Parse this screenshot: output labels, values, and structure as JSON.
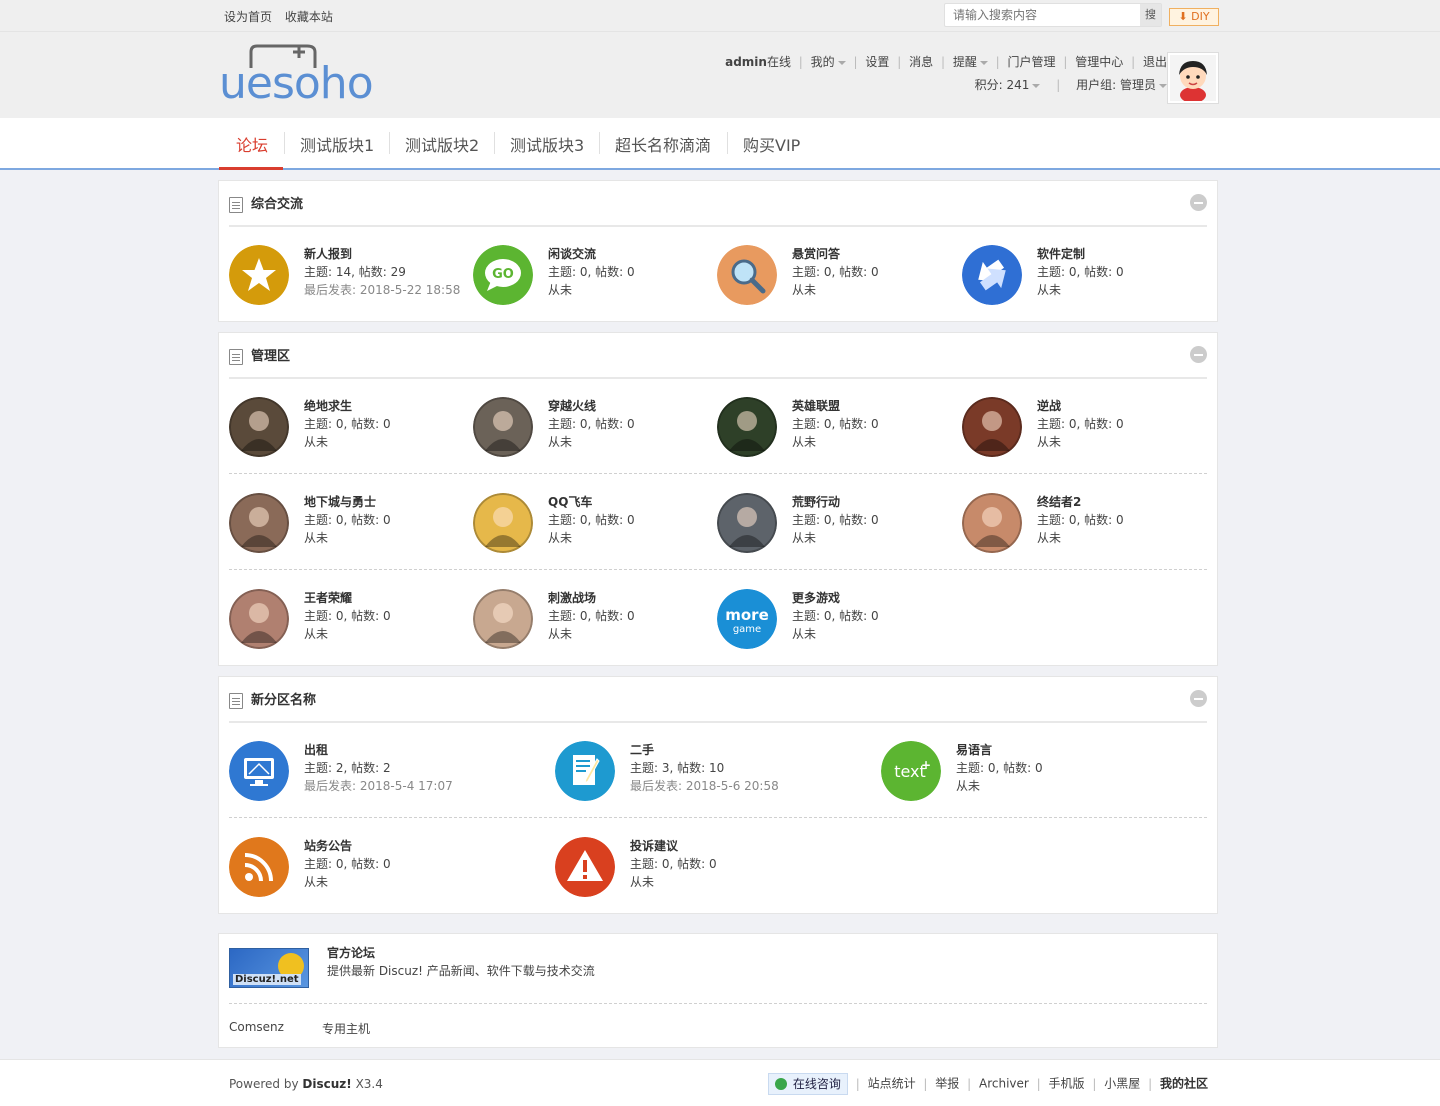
{
  "topbar": {
    "links": [
      "设为首页",
      "收藏本站"
    ],
    "search_placeholder": "请输入搜索内容",
    "search_button": "搜",
    "diy_label": "DIY"
  },
  "header": {
    "logo_text": "uesoho",
    "user_row1": [
      "admin在线",
      "我的",
      "设置",
      "消息",
      "提醒",
      "门户管理",
      "管理中心",
      "退出"
    ],
    "credits": "积分: 241",
    "usergroup": "用户组: 管理员"
  },
  "nav": {
    "items": [
      "论坛",
      "测试版块1",
      "测试版块2",
      "测试版块3",
      "超长名称滴滴",
      "购买VIP"
    ],
    "active": "论坛"
  },
  "colors": {
    "accent": "#d93d2e",
    "nav_border": "#7ea8e0",
    "logo": "#5b8fd3"
  },
  "sections": [
    {
      "title": "综合交流",
      "forums": [
        {
          "name": "新人报到",
          "stat": "主题: 14, 帖数: 29",
          "last": "最后发表: 2018-5-22 18:58",
          "icon": "star-icon",
          "color": "#d49b0b"
        },
        {
          "name": "闲谈交流",
          "stat": "主题: 0, 帖数: 0",
          "last": "从未",
          "icon": "chat-bubble-icon",
          "color": "#5cb531"
        },
        {
          "name": "悬赏问答",
          "stat": "主题: 0, 帖数: 0",
          "last": "从未",
          "icon": "magnifier-icon",
          "color": "#e89a5f"
        },
        {
          "name": "软件定制",
          "stat": "主题: 0, 帖数: 0",
          "last": "从未",
          "icon": "arrows-icon",
          "color": "#2f6fd4"
        }
      ]
    },
    {
      "title": "管理区",
      "forums": [
        {
          "name": "绝地求生",
          "stat": "主题: 0, 帖数: 0",
          "last": "从未",
          "icon": "game-avatar-icon",
          "color": "#5a4a3a"
        },
        {
          "name": "穿越火线",
          "stat": "主题: 0, 帖数: 0",
          "last": "从未",
          "icon": "game-avatar-icon",
          "color": "#6b6258"
        },
        {
          "name": "英雄联盟",
          "stat": "主题: 0, 帖数: 0",
          "last": "从未",
          "icon": "game-avatar-icon",
          "color": "#2e4028"
        },
        {
          "name": "逆战",
          "stat": "主题: 0, 帖数: 0",
          "last": "从未",
          "icon": "game-avatar-icon",
          "color": "#7a3a28"
        },
        {
          "name": "地下城与勇士",
          "stat": "主题: 0, 帖数: 0",
          "last": "从未",
          "icon": "game-avatar-icon",
          "color": "#8a6a58"
        },
        {
          "name": "QQ飞车",
          "stat": "主题: 0, 帖数: 0",
          "last": "从未",
          "icon": "game-avatar-icon",
          "color": "#e6b84a"
        },
        {
          "name": "荒野行动",
          "stat": "主题: 0, 帖数: 0",
          "last": "从未",
          "icon": "game-avatar-icon",
          "color": "#5d636a"
        },
        {
          "name": "终结者2",
          "stat": "主题: 0, 帖数: 0",
          "last": "从未",
          "icon": "game-avatar-icon",
          "color": "#c78a6a"
        },
        {
          "name": "王者荣耀",
          "stat": "主题: 0, 帖数: 0",
          "last": "从未",
          "icon": "game-avatar-icon",
          "color": "#b08070"
        },
        {
          "name": "刺激战场",
          "stat": "主题: 0, 帖数: 0",
          "last": "从未",
          "icon": "game-avatar-icon",
          "color": "#c8a890"
        },
        {
          "name": "更多游戏",
          "stat": "主题: 0, 帖数: 0",
          "last": "从未",
          "icon": "more-game-icon",
          "color": "#1a8fd6",
          "icon_text": "more",
          "icon_sub": "game"
        }
      ]
    },
    {
      "title": "新分区名称",
      "forums": [
        {
          "name": "出租",
          "stat": "主题: 2, 帖数: 2",
          "last": "最后发表: 2018-5-4 17:07",
          "icon": "monitor-icon",
          "color": "#2f78d2"
        },
        {
          "name": "二手",
          "stat": "主题: 3, 帖数: 10",
          "last": "最后发表: 2018-5-6 20:58",
          "icon": "document-edit-icon",
          "color": "#1e9ad0"
        },
        {
          "name": "易语言",
          "stat": "主题: 0, 帖数: 0",
          "last": "从未",
          "icon": "text-plus-icon",
          "color": "#5cb531",
          "icon_text": "text⁺"
        },
        {
          "name": "站务公告",
          "stat": "主题: 0, 帖数: 0",
          "last": "从未",
          "icon": "rss-icon",
          "color": "#e0781c"
        },
        {
          "name": "投诉建议",
          "stat": "主题: 0, 帖数: 0",
          "last": "从未",
          "icon": "warning-icon",
          "color": "#d9401f"
        }
      ]
    }
  ],
  "links_box": {
    "logo_text": "Discuz!.net",
    "title": "官方论坛",
    "desc": "提供最新 Discuz! 产品新闻、软件下载与技术交流",
    "text_links": [
      "Comsenz",
      "专用主机"
    ]
  },
  "footer": {
    "powered": "Powered by",
    "brand": "Discuz!",
    "version": "X3.4",
    "kefu": "在线咨询",
    "links": [
      "站点统计",
      "举报",
      "Archiver",
      "手机版",
      "小黑屋"
    ],
    "community": "我的社区"
  }
}
